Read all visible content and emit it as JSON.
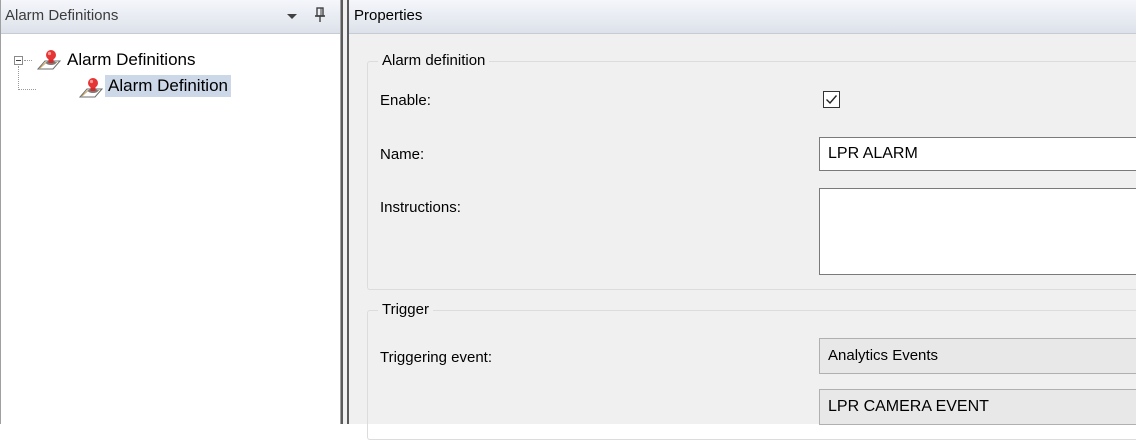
{
  "left_panel": {
    "title": "Alarm Definitions",
    "tree": {
      "root_label": "Alarm Definitions",
      "child_label": "Alarm Definition"
    }
  },
  "right_panel": {
    "title": "Properties",
    "alarm_definition": {
      "legend": "Alarm definition",
      "enable_label": "Enable:",
      "enable_checked": true,
      "name_label": "Name:",
      "name_value": "LPR ALARM",
      "instructions_label": "Instructions:",
      "instructions_value": ""
    },
    "trigger": {
      "legend": "Trigger",
      "triggering_event_label": "Triggering event:",
      "event_category": "Analytics Events",
      "event_name": "LPR CAMERA EVENT"
    }
  },
  "icons": {
    "dropdown": "dropdown-arrow-icon",
    "pin": "pin-icon",
    "alarm": "alarm-definition-icon"
  },
  "colors": {
    "selection": "#ccd7e8",
    "header": "#dde2ea",
    "panel_background": "#f0f0f0"
  }
}
